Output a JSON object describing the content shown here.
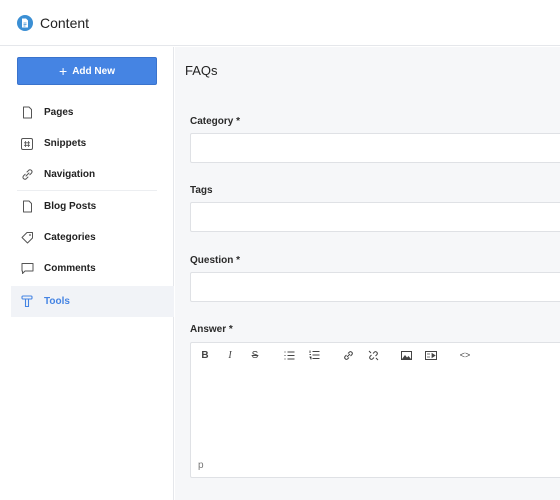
{
  "app": {
    "title": "Content",
    "logo_icon": "document-icon",
    "accent_color": "#4584e3"
  },
  "sidebar": {
    "add_button": {
      "icon": "plus-icon",
      "label": "Add New"
    },
    "items": [
      {
        "label": "Pages",
        "icon": "page-icon",
        "active": false
      },
      {
        "label": "Snippets",
        "icon": "hash-icon",
        "active": false
      },
      {
        "label": "Navigation",
        "icon": "link-icon",
        "active": false
      },
      {
        "label": "Blog Posts",
        "icon": "page-icon",
        "active": false
      },
      {
        "label": "Categories",
        "icon": "tag-icon",
        "active": false
      },
      {
        "label": "Comments",
        "icon": "comment-icon",
        "active": false
      },
      {
        "label": "Tools",
        "icon": "tools-icon",
        "active": true
      }
    ]
  },
  "main": {
    "page_title": "FAQs",
    "fields": [
      {
        "label": "Category *",
        "value": ""
      },
      {
        "label": "Tags",
        "value": ""
      },
      {
        "label": "Question *",
        "value": ""
      }
    ],
    "answer": {
      "label": "Answer *",
      "toolbar": [
        {
          "name": "bold",
          "glyph": "B"
        },
        {
          "name": "italic",
          "glyph": "I"
        },
        {
          "name": "strikethrough",
          "glyph": "S"
        },
        {
          "name": "bullet-list",
          "glyph": ""
        },
        {
          "name": "numbered-list",
          "glyph": ""
        },
        {
          "name": "link",
          "glyph": ""
        },
        {
          "name": "unlink",
          "glyph": ""
        },
        {
          "name": "image",
          "glyph": ""
        },
        {
          "name": "embed",
          "glyph": ""
        },
        {
          "name": "code",
          "glyph": "<>"
        }
      ],
      "value": "",
      "status_path": "p"
    }
  }
}
